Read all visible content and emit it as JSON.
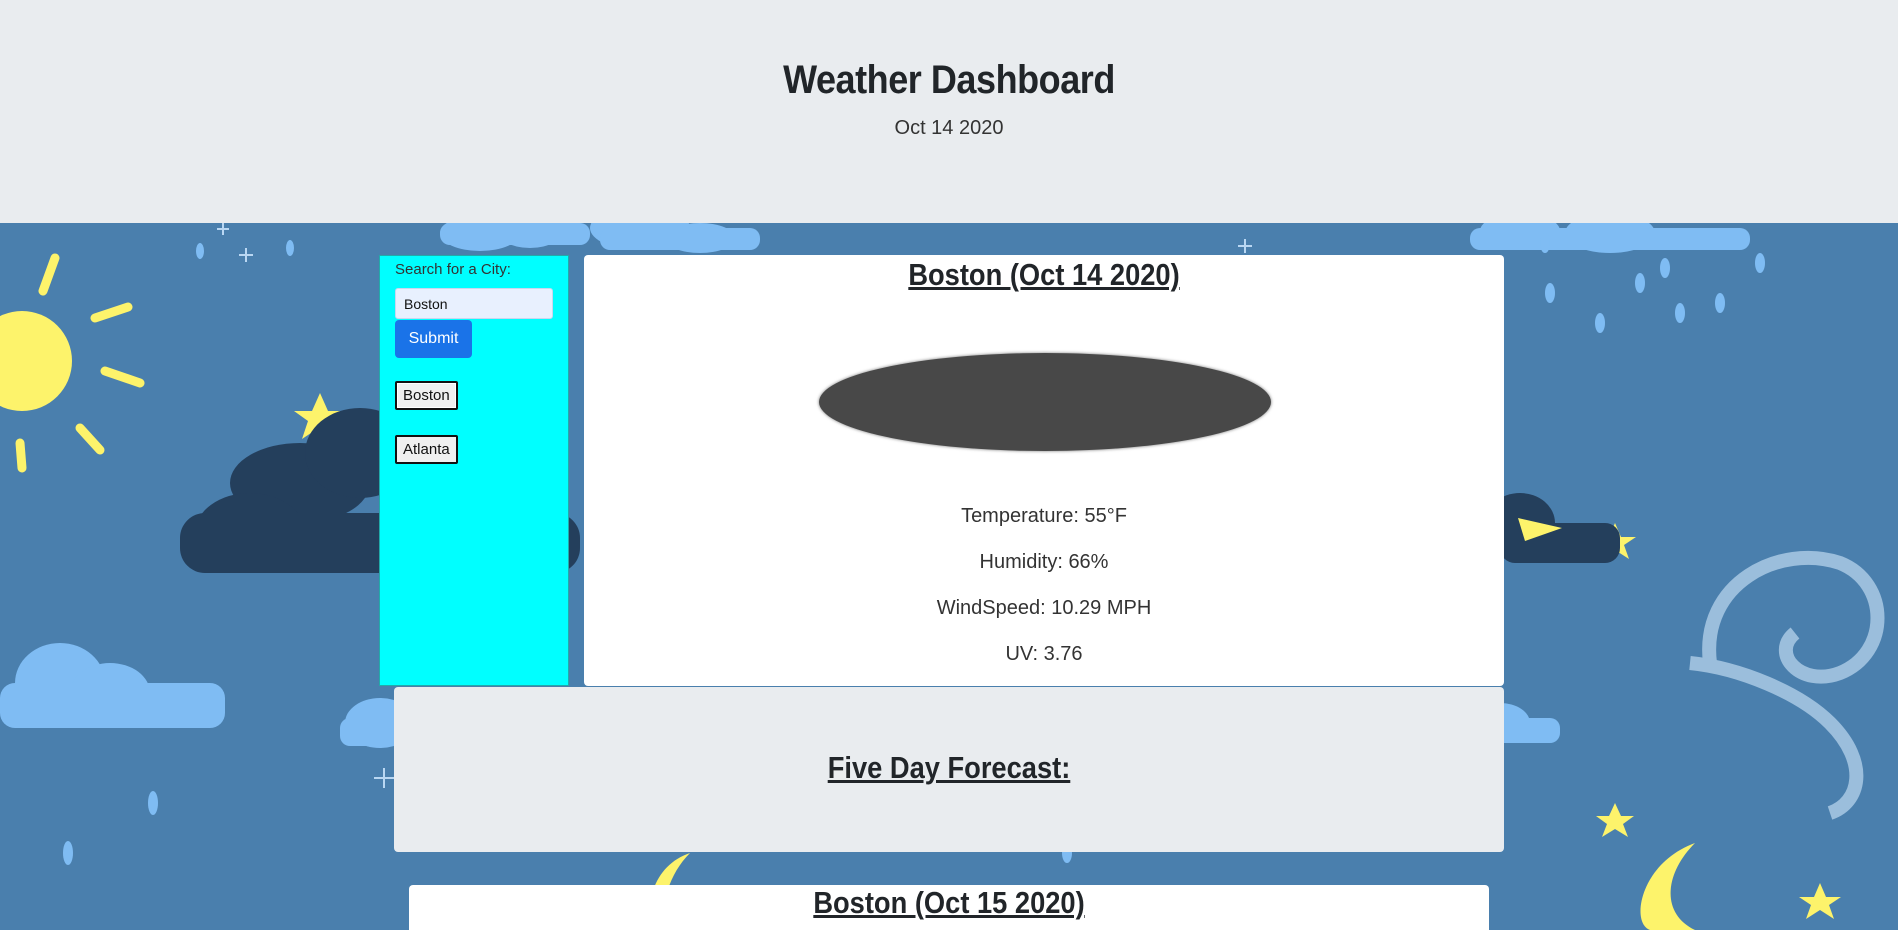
{
  "header": {
    "title": "Weather Dashboard",
    "date": "Oct 14 2020"
  },
  "sidebar": {
    "search_label": "Search for a City:",
    "search_value": "Boston",
    "submit_label": "Submit",
    "history": [
      "Boston",
      "Atlanta"
    ]
  },
  "current": {
    "heading": "Boston (Oct 14 2020)",
    "temperature": "Temperature: 55°F",
    "humidity": "Humidity: 66%",
    "windspeed": "WindSpeed: 10.29 MPH",
    "uv": "UV: 3.76",
    "icon": "weather-condition-icon"
  },
  "forecast": {
    "heading": "Five Day Forecast:",
    "days": [
      {
        "heading": "Boston (Oct 15 2020)"
      }
    ]
  },
  "colors": {
    "header_bg": "#e9ecef",
    "page_bg": "#4a7fad",
    "sidebar_bg": "#00ffff",
    "submit_bg": "#1a73e8"
  }
}
